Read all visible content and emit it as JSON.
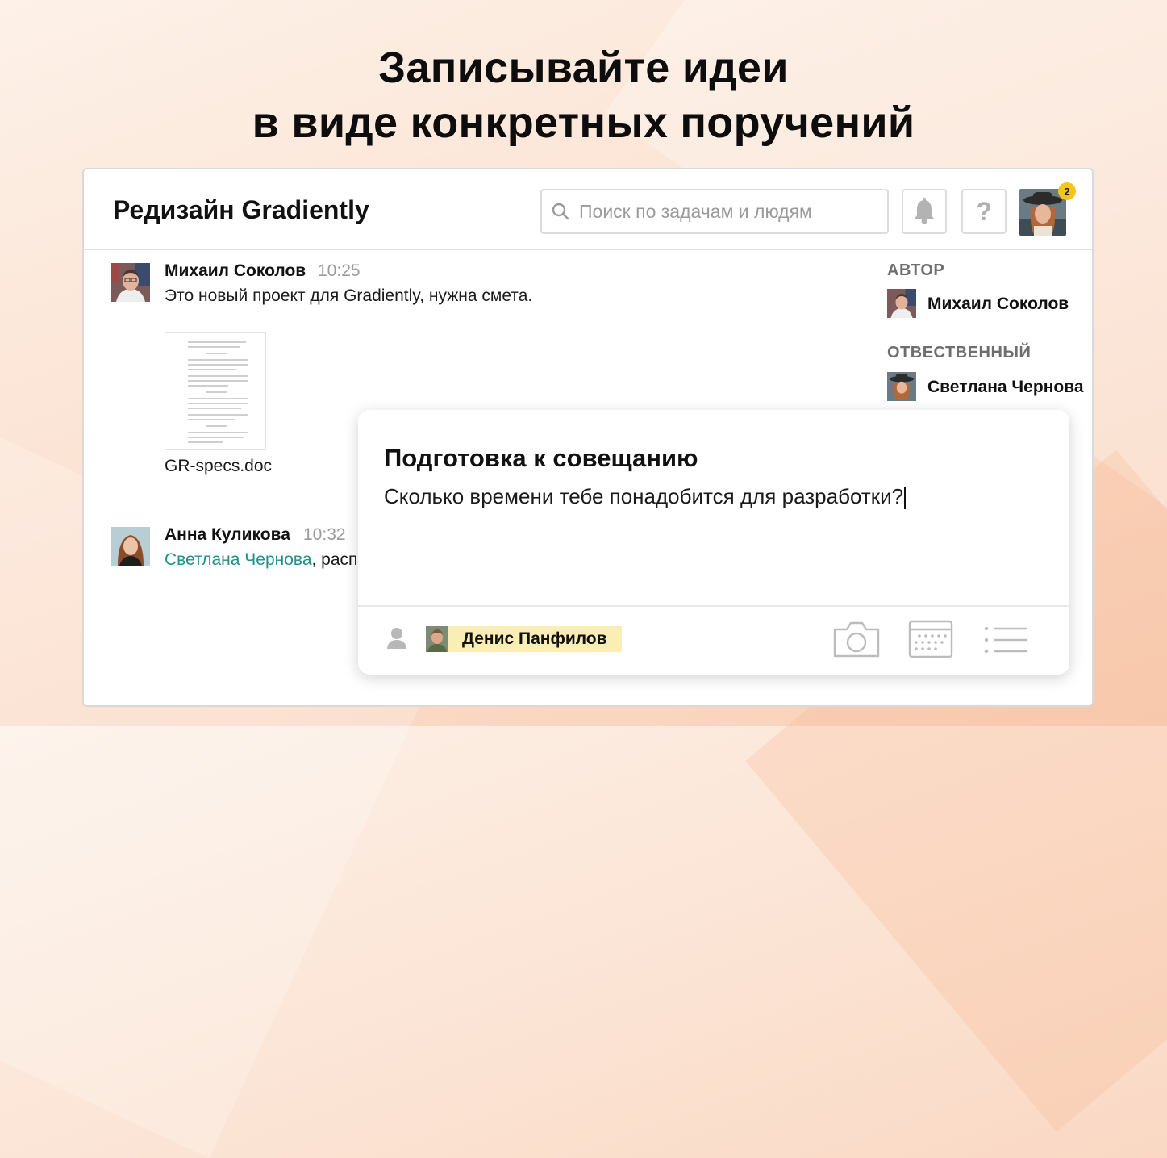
{
  "headline": {
    "line1": "Записывайте идеи",
    "line2": "в виде конкретных поручений"
  },
  "header": {
    "title": "Редизайн Gradiently",
    "search_placeholder": "Поиск по задачам и людям",
    "help_label": "?",
    "notification_count": "2",
    "icons": [
      "search-icon",
      "bell-icon",
      "help-icon"
    ]
  },
  "messages": [
    {
      "author": "Михаил Соколов",
      "time": "10:25",
      "text": "Это новый проект для Gradiently, нужна смета.",
      "attachment": "GR-specs.doc"
    },
    {
      "author": "Анна Куликова",
      "time": "10:32",
      "mention": "Светлана Чернова",
      "text": ", расп"
    }
  ],
  "sidebar": {
    "author_label": "АВТОР",
    "author_name": "Михаил Соколов",
    "assignee_label": "ОТВЕСТВЕННЫЙ",
    "assignee_name": "Светлана Чернова"
  },
  "task_popup": {
    "title": "Подготовка к совещанию",
    "text": "Сколько времени тебе понадобится для разработки?",
    "assignee": "Денис Панфилов",
    "icons": [
      "person-icon",
      "camera-icon",
      "calendar-icon",
      "list-icon"
    ]
  },
  "colors": {
    "mention": "#20908a",
    "badge": "#f5c51c",
    "chip": "#fbeeb4"
  }
}
